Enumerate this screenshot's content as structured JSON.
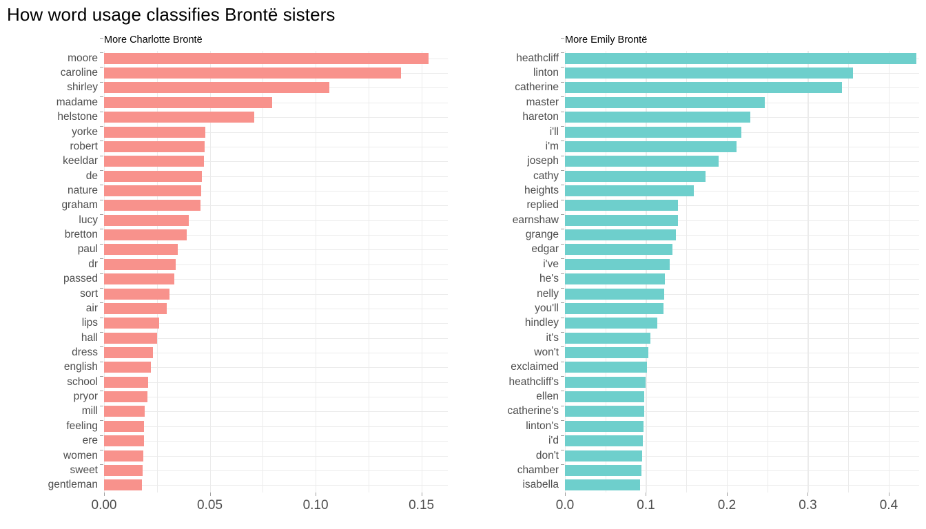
{
  "title": "How word usage classifies Brontë sisters",
  "colors": {
    "charlotte": "#f8928c",
    "emily": "#6ecfcc",
    "grid": "#ebebeb",
    "axis_text": "#4d4d4d",
    "background": "#ffffff"
  },
  "chart_data": {
    "type": "bar",
    "title": "How word usage classifies Brontë sisters",
    "orientation": "horizontal",
    "grid": true,
    "legend": "none",
    "panels": [
      {
        "name": "charlotte",
        "facet_label": "More Charlotte Brontë",
        "color": "#f8928c",
        "xlabel": "",
        "ylabel": "",
        "xlim": [
          0,
          0.1625
        ],
        "xticks": [
          "0.00",
          "0.05",
          "0.10",
          "0.15"
        ],
        "xtick_values": [
          0.0,
          0.05,
          0.1,
          0.15
        ],
        "categories": [
          "moore",
          "caroline",
          "shirley",
          "madame",
          "helstone",
          "yorke",
          "robert",
          "keeldar",
          "de",
          "nature",
          "graham",
          "lucy",
          "bretton",
          "paul",
          "dr",
          "passed",
          "sort",
          "air",
          "lips",
          "hall",
          "dress",
          "english",
          "school",
          "pryor",
          "mill",
          "feeling",
          "ere",
          "women",
          "sweet",
          "gentleman"
        ],
        "values": [
          0.1535,
          0.1405,
          0.1065,
          0.0795,
          0.071,
          0.0478,
          0.0475,
          0.0472,
          0.0462,
          0.0458,
          0.0455,
          0.04,
          0.0392,
          0.035,
          0.034,
          0.0332,
          0.031,
          0.0296,
          0.026,
          0.0252,
          0.0232,
          0.022,
          0.021,
          0.0205,
          0.0192,
          0.019,
          0.0188,
          0.0185,
          0.0182,
          0.0178
        ]
      },
      {
        "name": "emily",
        "facet_label": "More Emily Brontë",
        "color": "#6ecfcc",
        "xlabel": "",
        "ylabel": "",
        "xlim": [
          0,
          0.4375
        ],
        "xticks": [
          "0.0",
          "0.1",
          "0.2",
          "0.3",
          "0.4"
        ],
        "xtick_values": [
          0.0,
          0.1,
          0.2,
          0.3,
          0.4
        ],
        "categories": [
          "heathcliff",
          "linton",
          "catherine",
          "master",
          "hareton",
          "i'll",
          "i'm",
          "joseph",
          "cathy",
          "heights",
          "replied",
          "earnshaw",
          "grange",
          "edgar",
          "i've",
          "he's",
          "nelly",
          "you'll",
          "hindley",
          "it's",
          "won't",
          "exclaimed",
          "heathcliff's",
          "ellen",
          "catherine's",
          "linton's",
          "i'd",
          "don't",
          "chamber",
          "isabella"
        ],
        "values": [
          0.4345,
          0.3555,
          0.3425,
          0.2465,
          0.229,
          0.218,
          0.212,
          0.1895,
          0.174,
          0.159,
          0.14,
          0.1395,
          0.137,
          0.1325,
          0.129,
          0.1235,
          0.1225,
          0.1215,
          0.114,
          0.1055,
          0.103,
          0.101,
          0.0995,
          0.098,
          0.0975,
          0.097,
          0.096,
          0.095,
          0.0945,
          0.093
        ]
      }
    ]
  }
}
